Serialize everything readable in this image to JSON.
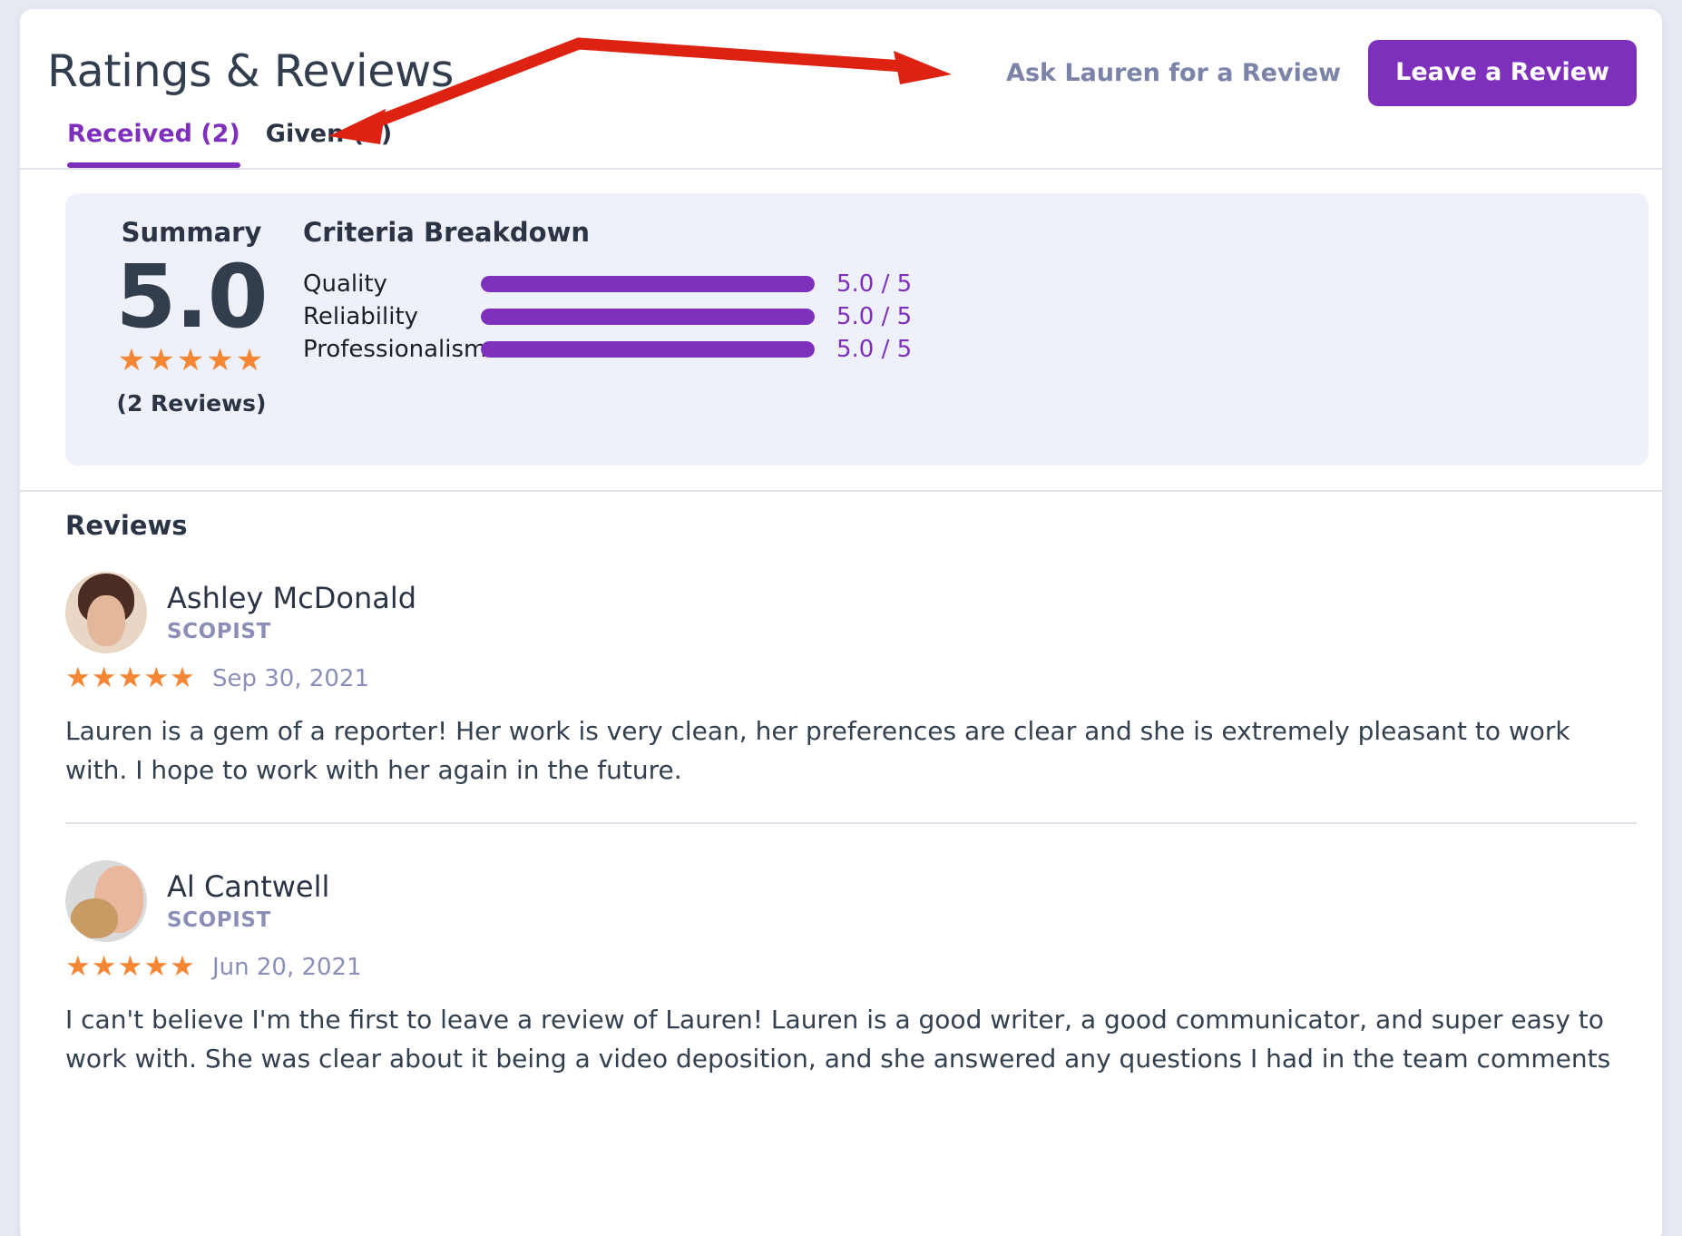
{
  "header": {
    "title": "Ratings & Reviews",
    "ask_link": "Ask Lauren for a Review",
    "leave_button": "Leave a Review"
  },
  "tabs": [
    {
      "label": "Received (2)",
      "active": true
    },
    {
      "label": "Given (6)",
      "active": false
    }
  ],
  "summary": {
    "label": "Summary",
    "score": "5.0",
    "stars": "★★★★★",
    "reviews_count": "(2 Reviews)",
    "criteria_title": "Criteria Breakdown",
    "criteria": [
      {
        "name": "Quality",
        "score_text": "5.0 / 5",
        "value": 5,
        "max": 5,
        "percent": 100
      },
      {
        "name": "Reliability",
        "score_text": "5.0 / 5",
        "value": 5,
        "max": 5,
        "percent": 100
      },
      {
        "name": "Professionalism",
        "score_text": "5.0 / 5",
        "value": 5,
        "max": 5,
        "percent": 100
      }
    ]
  },
  "reviews_section": {
    "heading": "Reviews",
    "items": [
      {
        "name": "Ashley McDonald",
        "role": "SCOPIST",
        "stars": "★★★★★",
        "date": "Sep 30, 2021",
        "body": "Lauren is a gem of a reporter! Her work is very clean, her preferences are clear and she is extremely pleasant to work with. I hope to work with her again in the future."
      },
      {
        "name": "Al Cantwell",
        "role": "SCOPIST",
        "stars": "★★★★★",
        "date": "Jun 20, 2021",
        "body": "I can't believe I'm the first to leave a review of Lauren!  Lauren is a good writer, a good communicator, and super easy to work with.  She was clear about it being a video deposition, and she answered any questions I had in the team comments"
      }
    ]
  },
  "colors": {
    "accent_purple": "#7e30bd",
    "star_orange": "#f58634",
    "muted_text": "#8b8fb8",
    "dark_text": "#2b3445",
    "panel_bg": "#eef1f9",
    "page_bg": "#e6eaf2",
    "annotation_red": "#dd2212"
  }
}
